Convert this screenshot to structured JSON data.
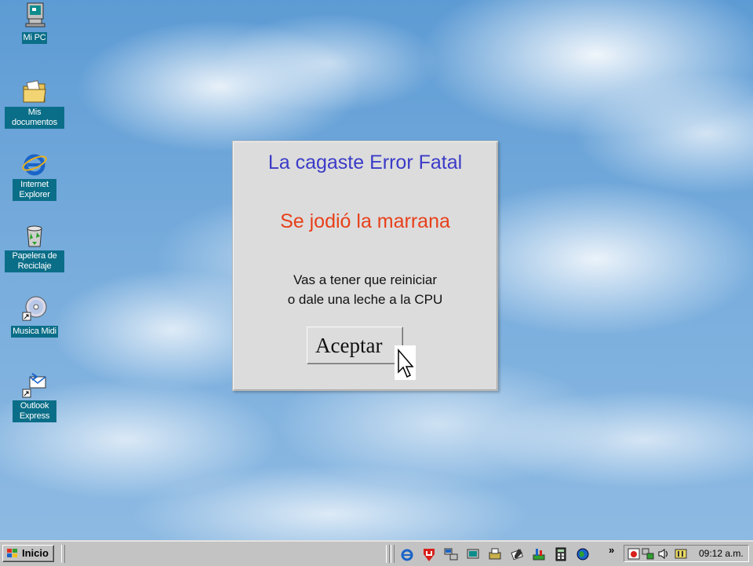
{
  "desktop_icons": [
    {
      "label": "Mi PC",
      "icon": "my-computer-icon"
    },
    {
      "label": "Mis documentos",
      "icon": "my-documents-icon"
    },
    {
      "label": "Internet Explorer",
      "icon": "internet-explorer-icon"
    },
    {
      "label": "Papelera de Reciclaje",
      "icon": "recycle-bin-icon"
    },
    {
      "label": "Musica Midi",
      "icon": "cd-audio-icon"
    },
    {
      "label": "Outlook Express",
      "icon": "outlook-express-icon"
    }
  ],
  "dialog": {
    "title": "La cagaste Error Fatal",
    "subtitle": "Se jodió la marrana",
    "message_line1": "Vas a tener que reiniciar",
    "message_line2": "o dale una leche a la CPU",
    "ok_label": "Aceptar"
  },
  "taskbar": {
    "start_label": "Inicio",
    "overflow_label": "»",
    "quick_launch": [
      "internet-explorer-icon",
      "antivirus-icon",
      "network-icon",
      "display-icon",
      "printer-icon",
      "pen-icon",
      "tools-icon",
      "calculator-icon",
      "globe-icon"
    ],
    "tray_icons": [
      "tray-program-icon",
      "tray-network-icon",
      "volume-icon",
      "tray-app-icon"
    ],
    "clock": "09:12 a.m."
  },
  "colors": {
    "title": "#3b3bc8",
    "subtitle": "#e8401a",
    "icon_label_bg": "#0b6e88",
    "dialog_bg": "#dcdcdc",
    "taskbar_bg": "#c3c3c3"
  }
}
